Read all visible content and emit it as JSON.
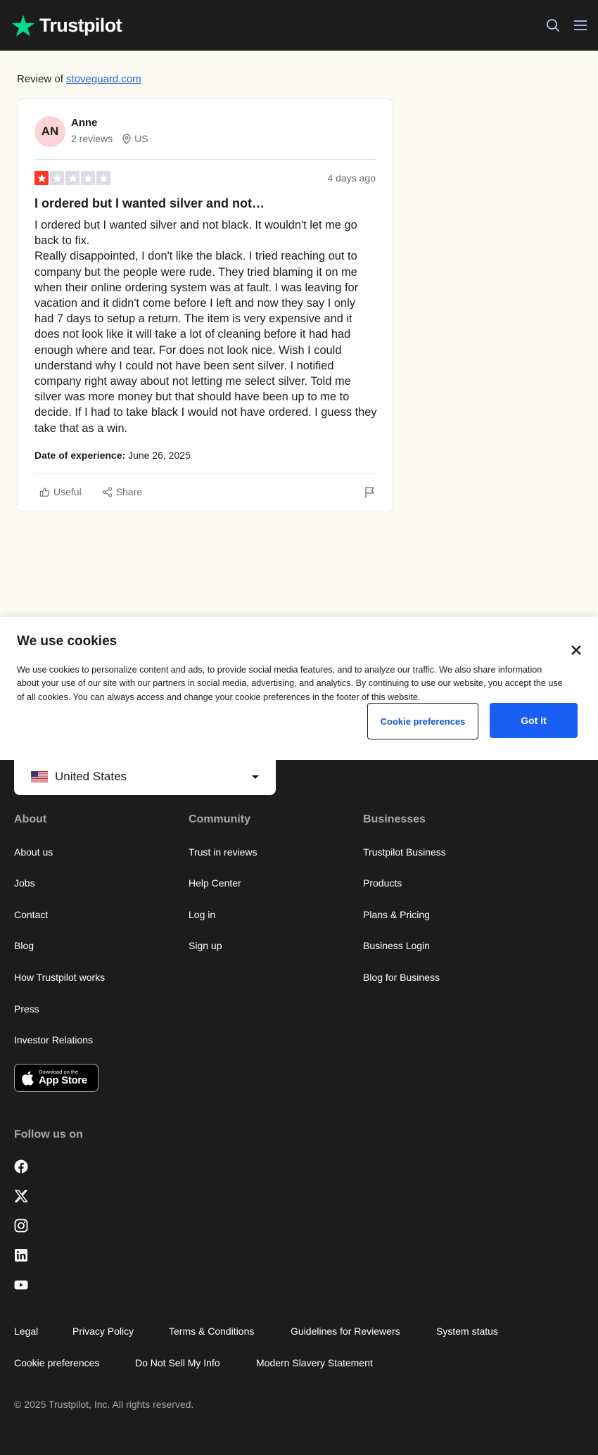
{
  "header": {
    "brand": "Trustpilot",
    "search_icon": "search-icon",
    "menu_icon": "hamburger-menu-icon"
  },
  "review_page": {
    "review_of_label": "Review of",
    "company_link": "stoveguard.com",
    "reviewer": {
      "initials": "AN",
      "name": "Anne",
      "review_count": "2 reviews",
      "country": "US"
    },
    "rating": 1,
    "max_rating": 5,
    "posted": "4 days ago",
    "title": "I ordered but I wanted silver and not…",
    "body_lines": [
      "I ordered but I wanted silver and not black. It wouldn't let me go back to fix.",
      "Really disappointed, I don't like the black. I tried reaching out to company but the people were rude. They tried blaming it on me when their online ordering system was at fault. I was leaving for vacation and it didn't come before I left and now they say I only had 7 days to setup a return. The item is very expensive and it does not look like it will take a lot of cleaning before it had had enough where and tear. For does not look nice. Wish I could understand why I could not have been sent silver. I notified company right away about not letting me select silver. Told me silver was more money but that should have been up to me to decide. If I had to take black I would not have ordered. I guess they take that as a win."
    ],
    "experience_label": "Date of experience:",
    "experience_date": "June 26, 2025",
    "useful_label": "Useful",
    "share_label": "Share"
  },
  "cookie_banner": {
    "title": "We use cookies",
    "text": "We use cookies to personalize content and ads, to provide social media features, and to analyze our traffic. We also share information about your use of our site with our partners in social media, advertising, and analytics. By continuing to use our website, you accept the use of all cookies. You can always access and change your cookie preferences in the footer of this website.",
    "preferences_button": "Cookie preferences",
    "accept_button": "Got it"
  },
  "footer": {
    "country_selected": "United States",
    "columns": [
      {
        "heading": "About",
        "links": [
          "About us",
          "Jobs",
          "Contact",
          "Blog",
          "How Trustpilot works",
          "Press",
          "Investor Relations"
        ]
      },
      {
        "heading": "Community",
        "links": [
          "Trust in reviews",
          "Help Center",
          "Log in",
          "Sign up"
        ]
      },
      {
        "heading": "Businesses",
        "links": [
          "Trustpilot Business",
          "Products",
          "Plans & Pricing",
          "Business Login",
          "Blog for Business"
        ]
      }
    ],
    "app_store": {
      "small": "Download on the",
      "big": "App Store"
    },
    "follow_heading": "Follow us on",
    "social_icons": [
      "facebook-icon",
      "x-icon",
      "instagram-icon",
      "linkedin-icon",
      "youtube-icon"
    ],
    "legal_row1": [
      "Legal",
      "Privacy Policy",
      "Terms & Conditions",
      "Guidelines for Reviewers",
      "System status"
    ],
    "legal_row2": [
      "Cookie preferences",
      "Do Not Sell My Info",
      "Modern Slavery Statement"
    ],
    "copyright": "© 2025 Trustpilot, Inc. All rights reserved."
  },
  "colors": {
    "header_bg": "#1c1c1c",
    "brand_star": "#04da8d",
    "rating_red": "#ff3722",
    "link_blue": "#2560d8",
    "primary_button": "#1a5ff4",
    "page_bg": "#fcfbf3"
  }
}
